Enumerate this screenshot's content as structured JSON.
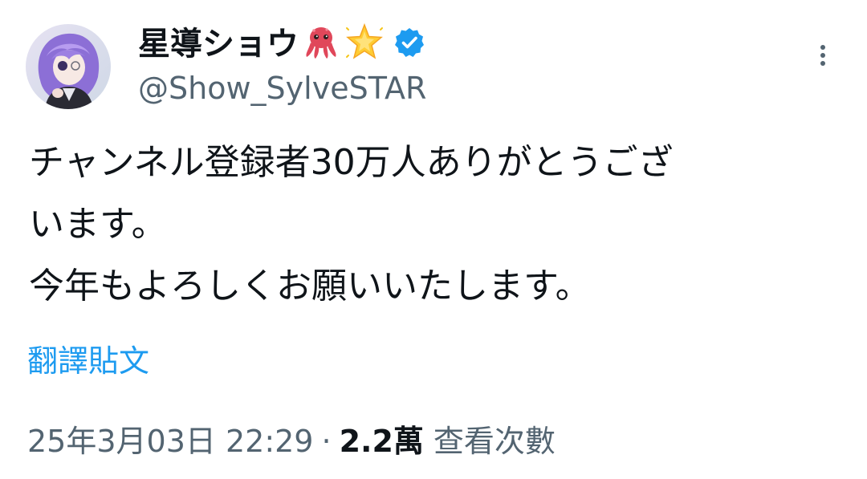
{
  "tweet": {
    "display_name": "星導ショウ",
    "name_emojis": [
      "octopus-emoji",
      "glowing-star-emoji"
    ],
    "handle": "@Show_SylveSTAR",
    "verified": true,
    "body_lines": [
      "チャンネル登録者30万人ありがとうござ",
      "います。",
      "今年もよろしくお願いいたします。"
    ],
    "translate_label": "翻譯貼文",
    "timestamp": "25年3月03日 22:29",
    "separator": "·",
    "views_count": "2.2萬",
    "views_label": "查看次數"
  },
  "colors": {
    "text_primary": "#0f1419",
    "text_secondary": "#536471",
    "link_blue": "#1d9bf0",
    "verified_blue": "#1d9bf0"
  },
  "icons": {
    "more": "more-vertical-icon",
    "verified": "verified-badge-icon"
  }
}
